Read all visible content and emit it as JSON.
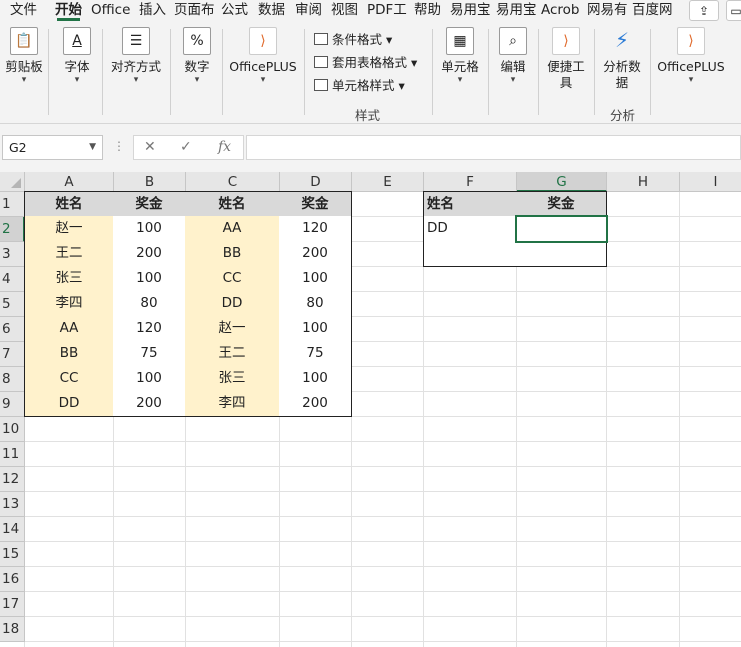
{
  "tabs": [
    "文件",
    "开始",
    "Office",
    "插入",
    "页面布",
    "公式",
    "数据",
    "审阅",
    "视图",
    "PDF工",
    "帮助",
    "易用宝",
    "易用宝",
    "Acrob",
    "网易有",
    "百度网"
  ],
  "active_tab": "开始",
  "ribbon": {
    "clipboard": "剪贴板",
    "font": "字体",
    "alignment": "对齐方式",
    "number": "数字",
    "officeplus": "OfficePLUS",
    "conditional_format": "条件格式",
    "table_format": "套用表格格式",
    "cell_style": "单元格样式",
    "styles_caption": "样式",
    "cells": "单元格",
    "editing": "编辑",
    "tools": "便捷工具",
    "analyze": "分析数据",
    "analyze_caption": "分析",
    "officeplus2": "OfficePLUS"
  },
  "formula_bar": {
    "name_box": "G2",
    "formula": "",
    "fx_label": "fx"
  },
  "columns": [
    "A",
    "B",
    "C",
    "D",
    "E",
    "F",
    "G",
    "H",
    "I"
  ],
  "rows": [
    "1",
    "2",
    "3",
    "4",
    "5",
    "6",
    "7",
    "8",
    "9",
    "10",
    "11",
    "12",
    "13",
    "14",
    "15",
    "16",
    "17",
    "18"
  ],
  "selected_cell": "G2",
  "table1": {
    "headers": [
      "姓名",
      "奖金"
    ],
    "rows": [
      [
        "赵一",
        "100"
      ],
      [
        "王二",
        "200"
      ],
      [
        "张三",
        "100"
      ],
      [
        "李四",
        "80"
      ],
      [
        "AA",
        "120"
      ],
      [
        "BB",
        "75"
      ],
      [
        "CC",
        "100"
      ],
      [
        "DD",
        "200"
      ]
    ]
  },
  "table2": {
    "headers": [
      "姓名",
      "奖金"
    ],
    "rows": [
      [
        "AA",
        "120"
      ],
      [
        "BB",
        "200"
      ],
      [
        "CC",
        "100"
      ],
      [
        "DD",
        "80"
      ],
      [
        "赵一",
        "100"
      ],
      [
        "王二",
        "75"
      ],
      [
        "张三",
        "100"
      ],
      [
        "李四",
        "200"
      ]
    ]
  },
  "lookup": {
    "headers": [
      "姓名",
      "奖金"
    ],
    "rows": [
      [
        "DD",
        ""
      ],
      [
        "",
        ""
      ]
    ]
  },
  "colors": {
    "accent": "#217346",
    "header_fill": "#d9d9d9",
    "name_fill": "#fff2cc"
  }
}
